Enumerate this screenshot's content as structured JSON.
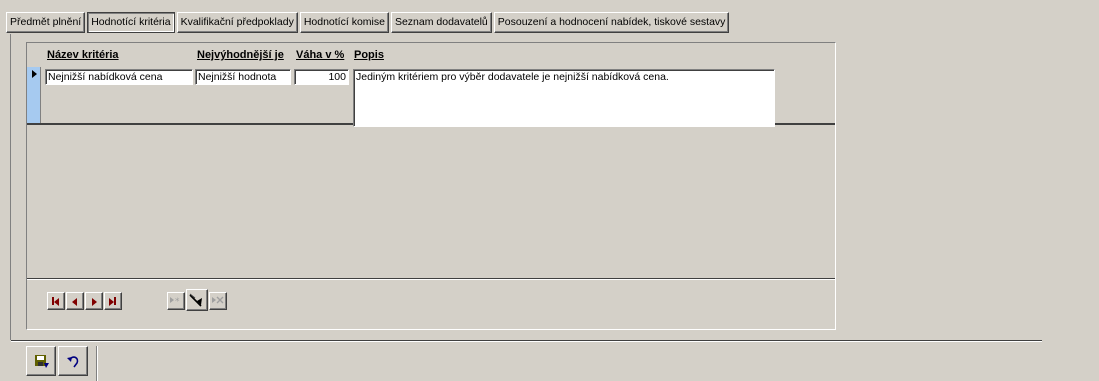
{
  "tabs": [
    {
      "label": "Předmět plnění"
    },
    {
      "label": "Hodnotící kritéria"
    },
    {
      "label": "Kvalifikační předpoklady"
    },
    {
      "label": "Hodnotící komise"
    },
    {
      "label": "Seznam dodavatelů"
    },
    {
      "label": "Posouzení a hodnocení nabídek, tiskové sestavy"
    }
  ],
  "active_tab": "Hodnotící kritéria",
  "grid": {
    "columns": [
      {
        "label": "Název kritéria"
      },
      {
        "label": "Nejvýhodnější je"
      },
      {
        "label": "Váha v %"
      },
      {
        "label": "Popis"
      }
    ],
    "rows": [
      {
        "nazev": "Nejnižší nabídková cena",
        "nejvyhodnejsi": "Nejnižší hodnota",
        "vaha": "100",
        "popis": "Jediným kritériem pro výběr dodavatele je nejnižší nabídková cena."
      }
    ]
  },
  "icons": {
    "nav_first": "first-record-icon",
    "nav_prev": "prev-record-icon",
    "nav_next": "next-record-icon",
    "nav_last": "last-record-icon",
    "nav_new": "new-record-icon",
    "nav_edit": "edit-record-icon",
    "nav_delete": "delete-record-icon",
    "save": "save-icon",
    "undo": "undo-icon"
  },
  "colors": {
    "background": "#d4d0c8",
    "selector": "#a6caf0",
    "nav_glyph": "#800000"
  }
}
